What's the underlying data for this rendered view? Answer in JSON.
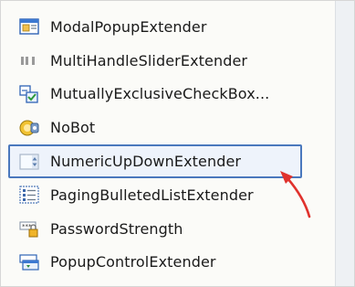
{
  "toolbox": {
    "items": [
      {
        "label": "ModalPopupExtender",
        "icon": "modal-popup-icon"
      },
      {
        "label": "MultiHandleSliderExtender",
        "icon": "slider-icon"
      },
      {
        "label": "MutuallyExclusiveCheckBox...",
        "icon": "checkbox-icon"
      },
      {
        "label": "NoBot",
        "icon": "nobot-icon"
      },
      {
        "label": "NumericUpDownExtender",
        "icon": "numeric-updown-icon",
        "selected": true
      },
      {
        "label": "PagingBulletedListExtender",
        "icon": "bulleted-list-icon"
      },
      {
        "label": "PasswordStrength",
        "icon": "password-strength-icon"
      },
      {
        "label": "PopupControlExtender",
        "icon": "popup-control-icon"
      }
    ]
  },
  "colors": {
    "selection_border": "#4a78bd",
    "selection_background": "#eef3fb",
    "arrow": "#e0322d"
  }
}
